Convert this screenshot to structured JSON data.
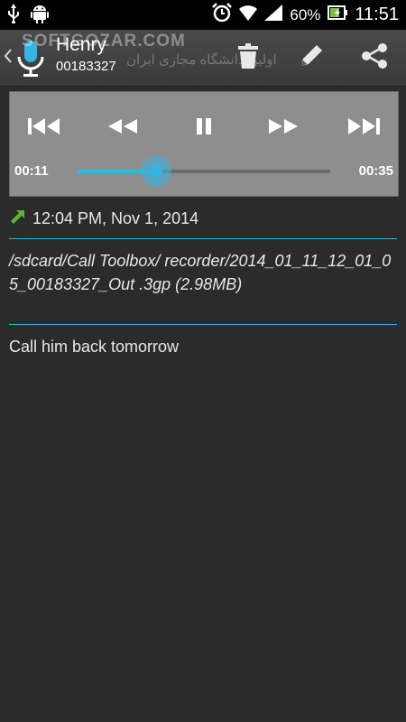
{
  "status_bar": {
    "battery": "60%",
    "time": "11:51",
    "icons": [
      "usb-icon",
      "android-debug-icon",
      "alarm-icon",
      "wifi-icon",
      "signal-icon",
      "battery-icon"
    ]
  },
  "action_bar": {
    "contact_name": "Henry",
    "contact_number": "00183327",
    "watermark": "SOFTGOZAR.COM",
    "watermark_sub": "اولین دانشگاه مجازی ایران",
    "actions": [
      "delete-icon",
      "edit-icon",
      "share-icon"
    ]
  },
  "player": {
    "current_time": "00:11",
    "total_time": "00:35",
    "progress": 0.31,
    "accent": "#33b5e5",
    "controls": [
      "skip-previous-icon",
      "rewind-icon",
      "pause-icon",
      "fast-forward-icon",
      "skip-next-icon"
    ]
  },
  "details": {
    "direction": "outgoing",
    "arrow_color": "#4caf50",
    "datetime": "12:04 PM, Nov 1, 2014",
    "file_path": "/sdcard/Call Toolbox/ recorder/2014_01_11_12_01_05_00183327_Out .3gp (2.98MB)",
    "note": "Call him back tomorrow"
  }
}
